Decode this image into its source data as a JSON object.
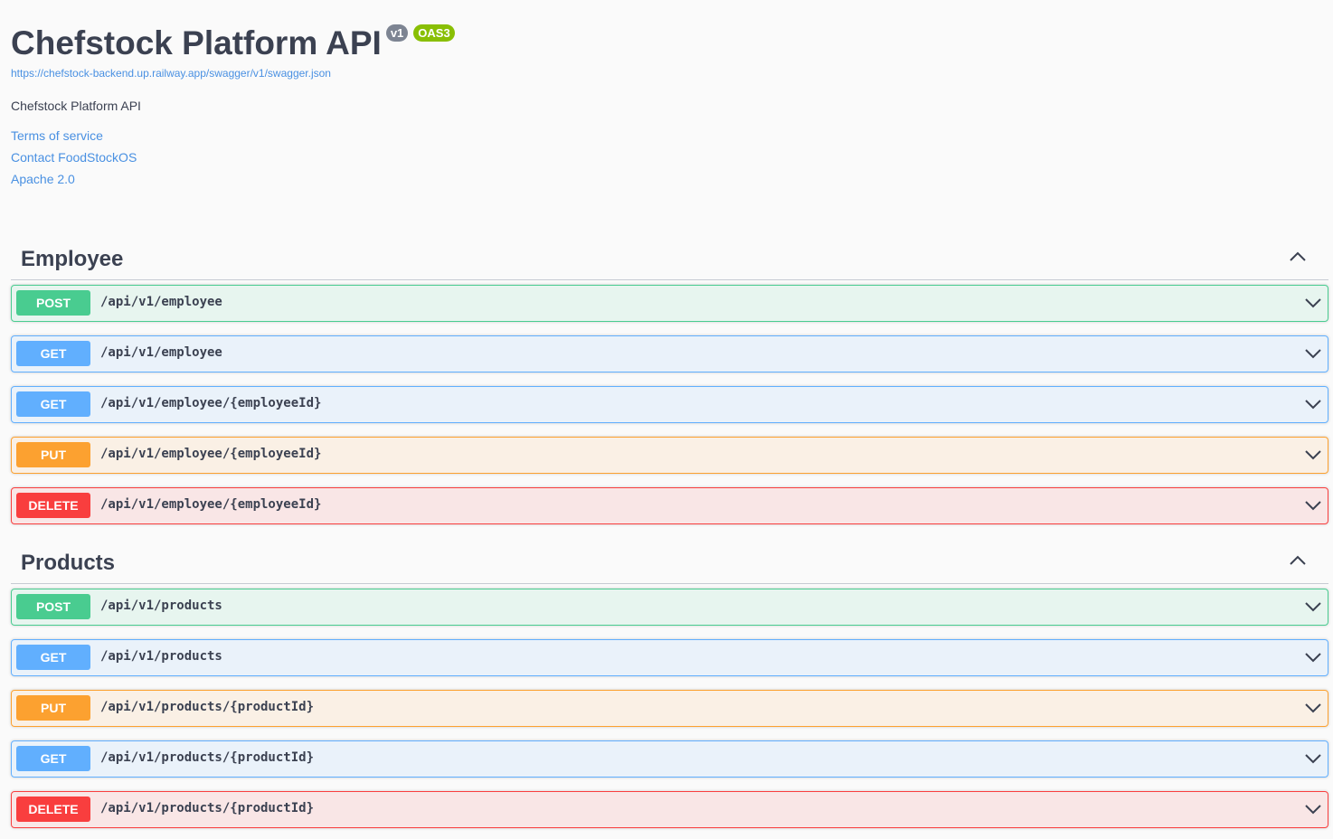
{
  "info": {
    "title": "Chefstock Platform API",
    "version_badge": "v1",
    "oas_badge": "OAS3",
    "spec_url": "https://chefstock-backend.up.railway.app/swagger/v1/swagger.json",
    "description": "Chefstock Platform API",
    "links": {
      "terms": "Terms of service",
      "contact": "Contact FoodStockOS",
      "license": "Apache 2.0"
    }
  },
  "colors": {
    "post": "#49cc90",
    "get": "#61affe",
    "put": "#fca130",
    "delete": "#f93e3e",
    "link": "#4990e2",
    "version_badge": "#7d8492",
    "oas_badge": "#89bf04"
  },
  "tags": [
    {
      "name": "Employee",
      "toggle_icon": "chevron-up-icon",
      "operations": [
        {
          "method": "POST",
          "path": "/api/v1/employee"
        },
        {
          "method": "GET",
          "path": "/api/v1/employee"
        },
        {
          "method": "GET",
          "path": "/api/v1/employee/{employeeId}"
        },
        {
          "method": "PUT",
          "path": "/api/v1/employee/{employeeId}"
        },
        {
          "method": "DELETE",
          "path": "/api/v1/employee/{employeeId}"
        }
      ]
    },
    {
      "name": "Products",
      "toggle_icon": "chevron-up-icon",
      "operations": [
        {
          "method": "POST",
          "path": "/api/v1/products"
        },
        {
          "method": "GET",
          "path": "/api/v1/products"
        },
        {
          "method": "PUT",
          "path": "/api/v1/products/{productId}"
        },
        {
          "method": "GET",
          "path": "/api/v1/products/{productId}"
        },
        {
          "method": "DELETE",
          "path": "/api/v1/products/{productId}"
        }
      ]
    }
  ]
}
